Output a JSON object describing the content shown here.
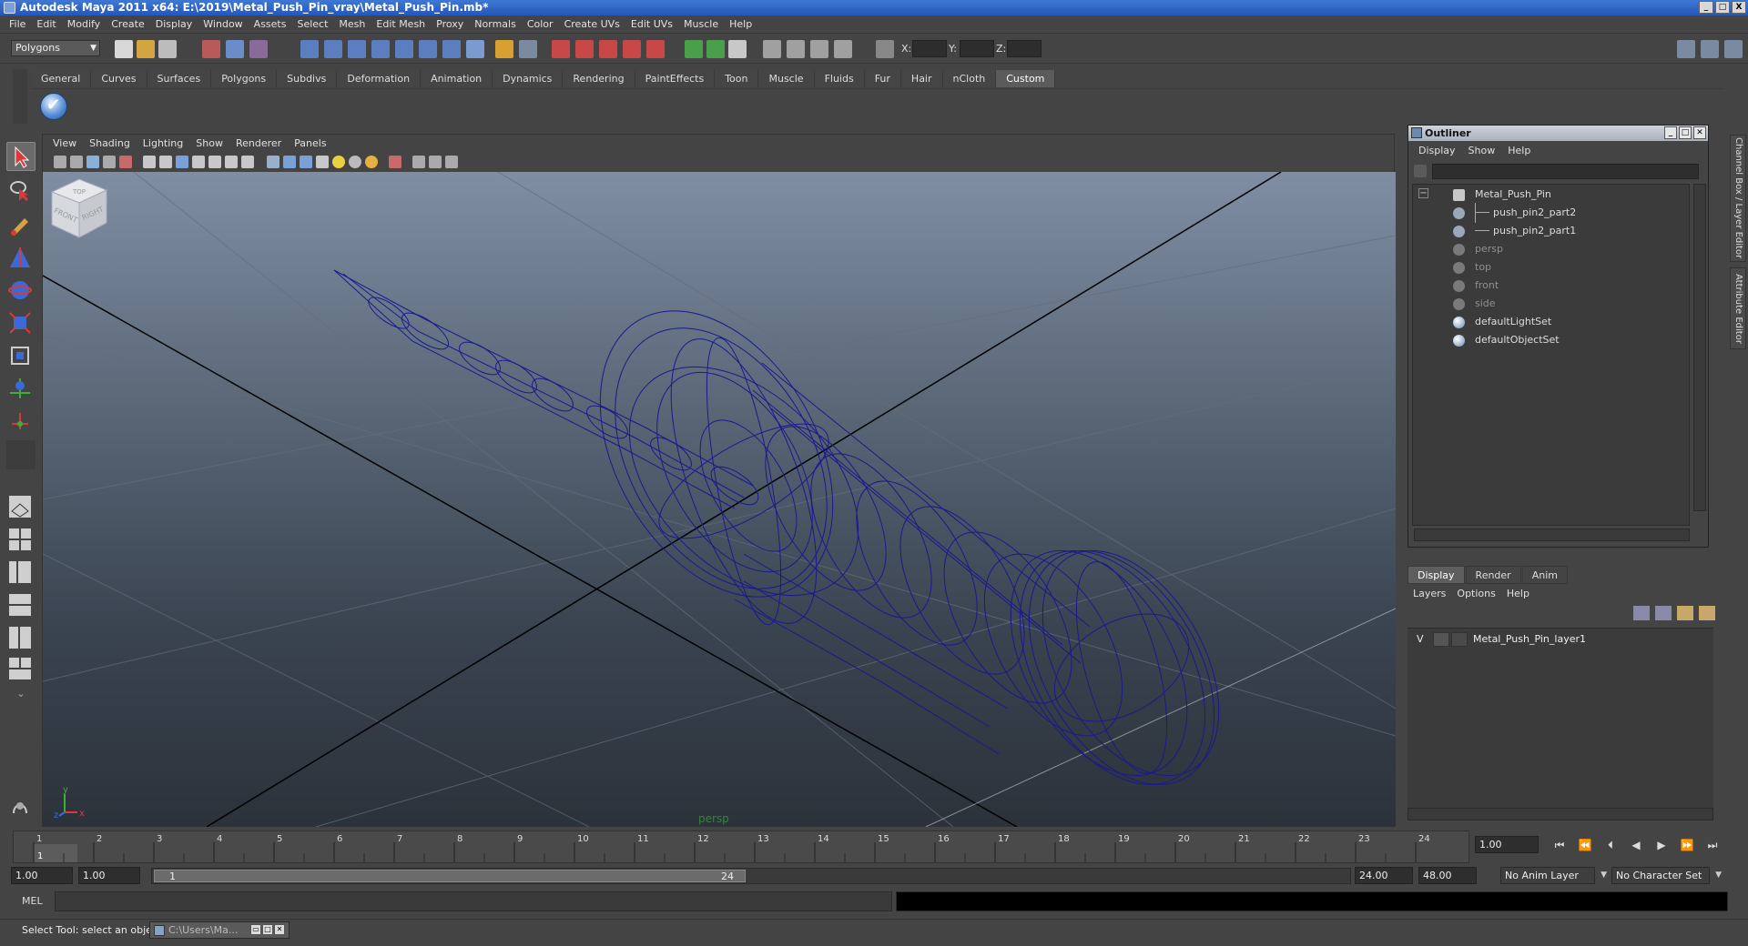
{
  "window": {
    "title": "Autodesk Maya 2011 x64: E:\\2019\\Metal_Push_Pin_vray\\Metal_Push_Pin.mb*",
    "controls": [
      "_",
      "□",
      "X"
    ]
  },
  "menubar": [
    "File",
    "Edit",
    "Modify",
    "Create",
    "Display",
    "Window",
    "Assets",
    "Select",
    "Mesh",
    "Edit Mesh",
    "Proxy",
    "Normals",
    "Color",
    "Create UVs",
    "Edit UVs",
    "Muscle",
    "Help"
  ],
  "statusline": {
    "mode": "Polygons",
    "x_label": "X:",
    "y_label": "Y:",
    "z_label": "Z:"
  },
  "shelf": {
    "tabs": [
      "General",
      "Curves",
      "Surfaces",
      "Polygons",
      "Subdivs",
      "Deformation",
      "Animation",
      "Dynamics",
      "Rendering",
      "PaintEffects",
      "Toon",
      "Muscle",
      "Fluids",
      "Fur",
      "Hair",
      "nCloth",
      "Custom"
    ],
    "active_tab": "Custom"
  },
  "viewport": {
    "menu": [
      "View",
      "Shading",
      "Lighting",
      "Show",
      "Renderer",
      "Panels"
    ],
    "camera": "persp",
    "viewcube": {
      "front": "FRONT",
      "right": "RIGHT",
      "top": "TOP"
    },
    "axis": {
      "x": "x",
      "y": "y",
      "z": "z"
    },
    "wire_color": "#1a1a8c"
  },
  "outliner": {
    "title": "Outliner",
    "menu": [
      "Display",
      "Show",
      "Help"
    ],
    "items": [
      {
        "label": "Metal_Push_Pin",
        "dim": false,
        "icon": "transform-icon"
      },
      {
        "label": "push_pin2_part2",
        "dim": false,
        "icon": "mesh-icon"
      },
      {
        "label": "push_pin2_part1",
        "dim": false,
        "icon": "mesh-icon"
      },
      {
        "label": "persp",
        "dim": true,
        "icon": "camera-icon"
      },
      {
        "label": "top",
        "dim": true,
        "icon": "camera-icon"
      },
      {
        "label": "front",
        "dim": true,
        "icon": "camera-icon"
      },
      {
        "label": "side",
        "dim": true,
        "icon": "camera-icon"
      },
      {
        "label": "defaultLightSet",
        "dim": false,
        "icon": "set-icon"
      },
      {
        "label": "defaultObjectSet",
        "dim": false,
        "icon": "set-icon"
      }
    ]
  },
  "layer_editor": {
    "tabs": [
      "Display",
      "Render",
      "Anim"
    ],
    "active_tab": "Display",
    "menu": [
      "Layers",
      "Options",
      "Help"
    ],
    "layer": {
      "visibility": "V",
      "name": "Metal_Push_Pin_layer1"
    }
  },
  "side_tabs": [
    "Channel Box / Layer Editor",
    "Attribute Editor"
  ],
  "timeline": {
    "ticks": [
      "1",
      "2",
      "3",
      "4",
      "5",
      "6",
      "7",
      "8",
      "9",
      "10",
      "11",
      "12",
      "13",
      "14",
      "15",
      "16",
      "17",
      "18",
      "19",
      "20",
      "21",
      "22",
      "23",
      "24"
    ],
    "current_frame_marker": "1",
    "current_time": "1.00"
  },
  "range": {
    "start_time": "1.00",
    "playback_start": "1.00",
    "range_start_label": "1",
    "range_end_label": "24",
    "playback_end": "24.00",
    "end_time": "48.00",
    "anim_layer": "No Anim Layer",
    "character_set": "No Character Set"
  },
  "command_line": {
    "label": "MEL"
  },
  "help_line": {
    "text": "Select Tool: select an object",
    "task": "C:\\Users\\Ma..."
  }
}
